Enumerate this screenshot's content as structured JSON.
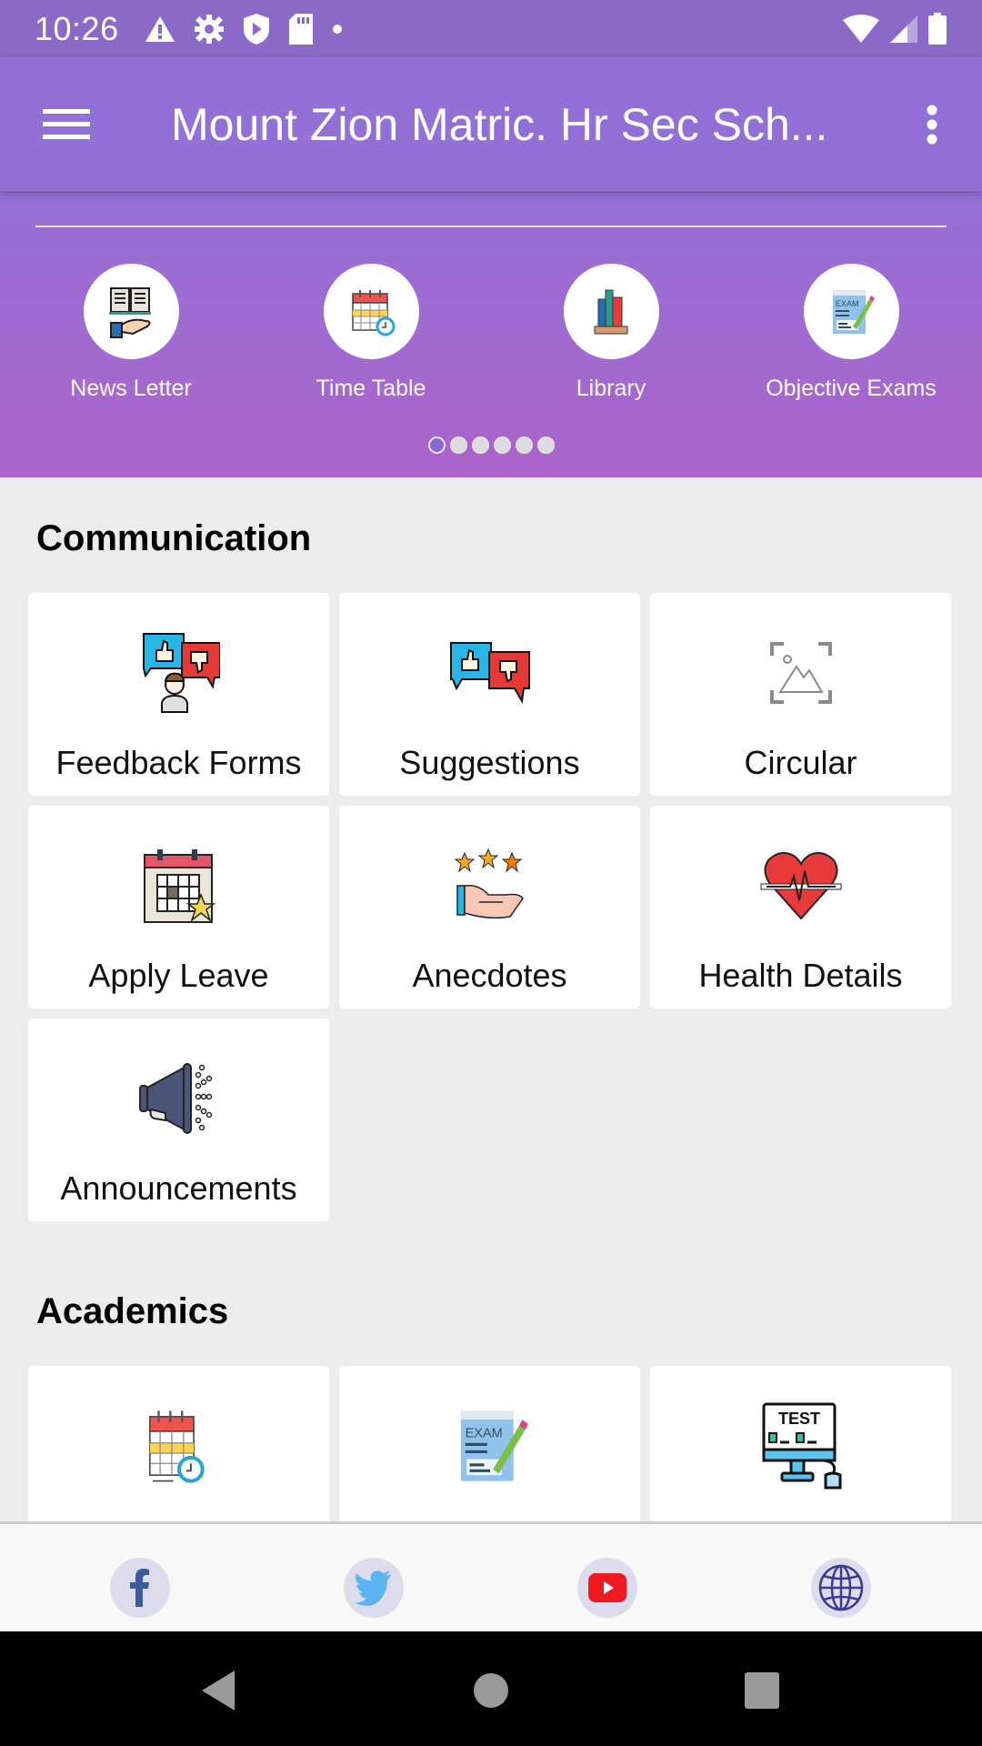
{
  "status_bar": {
    "time": "10:26",
    "left_icons": [
      "alert-icon",
      "gear-icon",
      "shield-play-icon",
      "sd-card-icon",
      "dot-icon"
    ],
    "right_icons": [
      "wifi-icon",
      "cell-signal-icon",
      "battery-icon"
    ]
  },
  "app_bar": {
    "title": "Mount Zion Matric. Hr Sec Sch...",
    "menu_icon": "hamburger-menu-icon",
    "overflow_icon": "more-vert-icon"
  },
  "colors": {
    "status_bar": "#8a6ac6",
    "app_bar": "#9370d6",
    "banner_top": "#9570d6",
    "banner_bottom": "#ab64cb",
    "page_bg": "#ececec"
  },
  "quick_links": [
    {
      "label": "News Letter",
      "icon": "newsletter-book-hand-icon"
    },
    {
      "label": "Time Table",
      "icon": "calendar-clock-icon"
    },
    {
      "label": "Library",
      "icon": "books-icon"
    },
    {
      "label": "Objective Exams",
      "icon": "exam-paper-pencil-icon"
    }
  ],
  "pager": {
    "count": 6,
    "active_index": 0
  },
  "sections": [
    {
      "title": "Communication",
      "tiles": [
        {
          "label": "Feedback Forms",
          "icon": "feedback-thumbs-person-icon"
        },
        {
          "label": "Suggestions",
          "icon": "thumbs-up-down-bubbles-icon"
        },
        {
          "label": "Circular",
          "icon": "image-placeholder-icon"
        },
        {
          "label": "Apply Leave",
          "icon": "calendar-star-icon"
        },
        {
          "label": "Anecdotes",
          "icon": "stars-hand-icon"
        },
        {
          "label": "Health Details",
          "icon": "heart-pulse-icon"
        },
        {
          "label": "Announcements",
          "icon": "megaphone-icon"
        }
      ]
    },
    {
      "title": "Academics",
      "tiles": [
        {
          "label": "",
          "icon": "calendar-clock-icon"
        },
        {
          "label": "",
          "icon": "exam-paper-pencil-icon"
        },
        {
          "label": "",
          "icon": "computer-test-icon"
        }
      ]
    }
  ],
  "footer": {
    "social": [
      {
        "name": "facebook",
        "icon": "facebook-icon"
      },
      {
        "name": "twitter",
        "icon": "twitter-icon"
      },
      {
        "name": "youtube",
        "icon": "youtube-icon"
      },
      {
        "name": "website",
        "icon": "globe-icon"
      }
    ]
  },
  "nav_bar": {
    "buttons": [
      "back-icon",
      "home-icon",
      "recents-icon"
    ]
  }
}
